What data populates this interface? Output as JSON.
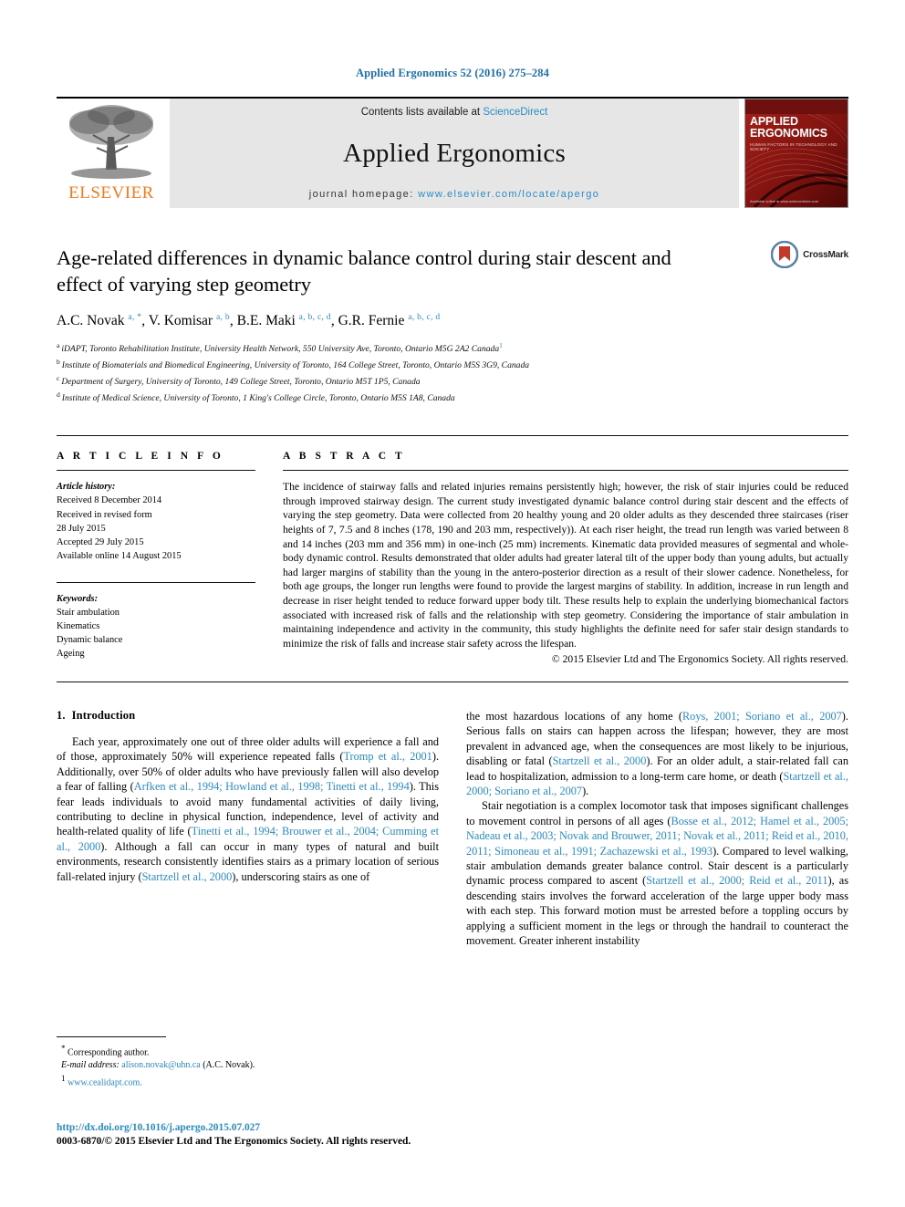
{
  "running_head": "Applied Ergonomics 52 (2016) 275–284",
  "masthead": {
    "publisher_name": "ELSEVIER",
    "contents_prefix": "Contents lists available at ",
    "contents_link": "ScienceDirect",
    "journal_name": "Applied Ergonomics",
    "homepage_prefix": "journal homepage: ",
    "homepage_url": "www.elsevier.com/locate/apergo",
    "cover": {
      "title_line1": "APPLIED",
      "title_line2": "ERGONOMICS",
      "subtitle": "HUMAN FACTORS IN TECHNOLOGY AND SOCIETY",
      "footer": "Available online at www.sciencedirect.com"
    }
  },
  "article": {
    "title": "Age-related differences in dynamic balance control during stair descent and effect of varying step geometry",
    "crossmark_label": "CrossMark",
    "authors": [
      {
        "name": "A.C. Novak",
        "sup": "a, *"
      },
      {
        "name": "V. Komisar",
        "sup": "a, b"
      },
      {
        "name": "B.E. Maki",
        "sup": "a, b, c, d"
      },
      {
        "name": "G.R. Fernie",
        "sup": "a, b, c, d"
      }
    ],
    "affiliations": [
      {
        "label": "a",
        "text": "iDAPT, Toronto Rehabilitation Institute, University Health Network, 550 University Ave, Toronto, Ontario M5G 2A2 Canada",
        "dagger": "1"
      },
      {
        "label": "b",
        "text": "Institute of Biomaterials and Biomedical Engineering, University of Toronto, 164 College Street, Toronto, Ontario M5S 3G9, Canada",
        "dagger": ""
      },
      {
        "label": "c",
        "text": "Department of Surgery, University of Toronto, 149 College Street, Toronto, Ontario M5T 1P5, Canada",
        "dagger": ""
      },
      {
        "label": "d",
        "text": "Institute of Medical Science, University of Toronto, 1 King's College Circle, Toronto, Ontario M5S 1A8, Canada",
        "dagger": ""
      }
    ]
  },
  "article_info": {
    "heading": "A R T I C L E  I N F O",
    "history_label": "Article history:",
    "history": [
      "Received 8 December 2014",
      "Received in revised form",
      "28 July 2015",
      "Accepted 29 July 2015",
      "Available online 14 August 2015"
    ],
    "keywords_label": "Keywords:",
    "keywords": [
      "Stair ambulation",
      "Kinematics",
      "Dynamic balance",
      "Ageing"
    ]
  },
  "abstract": {
    "heading": "A B S T R A C T",
    "text": "The incidence of stairway falls and related injuries remains persistently high; however, the risk of stair injuries could be reduced through improved stairway design. The current study investigated dynamic balance control during stair descent and the effects of varying the step geometry. Data were collected from 20 healthy young and 20 older adults as they descended three staircases (riser heights of 7, 7.5 and 8 inches (178, 190 and 203 mm, respectively)). At each riser height, the tread run length was varied between 8 and 14 inches (203 mm and 356 mm) in one-inch (25 mm) increments. Kinematic data provided measures of segmental and whole-body dynamic control. Results demonstrated that older adults had greater lateral tilt of the upper body than young adults, but actually had larger margins of stability than the young in the antero-posterior direction as a result of their slower cadence. Nonetheless, for both age groups, the longer run lengths were found to provide the largest margins of stability. In addition, increase in run length and decrease in riser height tended to reduce forward upper body tilt. These results help to explain the underlying biomechanical factors associated with increased risk of falls and the relationship with step geometry. Considering the importance of stair ambulation in maintaining independence and activity in the community, this study highlights the definite need for safer stair design standards to minimize the risk of falls and increase stair safety across the lifespan.",
    "copyright": "© 2015 Elsevier Ltd and The Ergonomics Society. All rights reserved."
  },
  "body": {
    "section_number": "1.",
    "section_title": "Introduction",
    "left_paragraphs": [
      "Each year, approximately one out of three older adults will experience a fall and of those, approximately 50% will experience repeated falls (Tromp et al., 2001). Additionally, over 50% of older adults who have previously fallen will also develop a fear of falling (Arfken et al., 1994; Howland et al., 1998; Tinetti et al., 1994). This fear leads individuals to avoid many fundamental activities of daily living, contributing to decline in physical function, independence, level of activity and health-related quality of life (Tinetti et al., 1994; Brouwer et al., 2004; Cumming et al., 2000). Although a fall can occur in many types of natural and built environments, research consistently identifies stairs as a primary location of serious fall-related injury (Startzell et al., 2000), underscoring stairs as one of"
    ],
    "right_paragraphs": [
      "the most hazardous locations of any home (Roys, 2001; Soriano et al., 2007). Serious falls on stairs can happen across the lifespan; however, they are most prevalent in advanced age, when the consequences are most likely to be injurious, disabling or fatal (Startzell et al., 2000). For an older adult, a stair-related fall can lead to hospitalization, admission to a long-term care home, or death (Startzell et al., 2000; Soriano et al., 2007).",
      "Stair negotiation is a complex locomotor task that imposes significant challenges to movement control in persons of all ages (Bosse et al., 2012; Hamel et al., 2005; Nadeau et al., 2003; Novak and Brouwer, 2011; Novak et al., 2011; Reid et al., 2010, 2011; Simoneau et al., 1991; Zachazewski et al., 1993). Compared to level walking, stair ambulation demands greater balance control. Stair descent is a particularly dynamic process compared to ascent (Startzell et al., 2000; Reid et al., 2011), as descending stairs involves the forward acceleration of the large upper body mass with each step. This forward motion must be arrested before a toppling occurs by applying a sufficient moment in the legs or through the handrail to counteract the movement. Greater inherent instability"
    ]
  },
  "footnotes": {
    "corresponding_symbol": "*",
    "corresponding_text": "Corresponding author.",
    "email_label": "E-mail address:",
    "email": "alison.novak@uhn.ca",
    "email_suffix": "(A.C. Novak).",
    "note_symbol": "1",
    "note_url": "www.cealidapt.com."
  },
  "page_footer": {
    "doi": "http://dx.doi.org/10.1016/j.apergo.2015.07.027",
    "issn_line": "0003-6870/© 2015 Elsevier Ltd and The Ergonomics Society. All rights reserved."
  },
  "colors": {
    "link_blue": "#2b8bc4",
    "elsevier_orange": "#f07c1e",
    "cover_red": "#8c1713",
    "masthead_grey": "#e6e6e6"
  }
}
